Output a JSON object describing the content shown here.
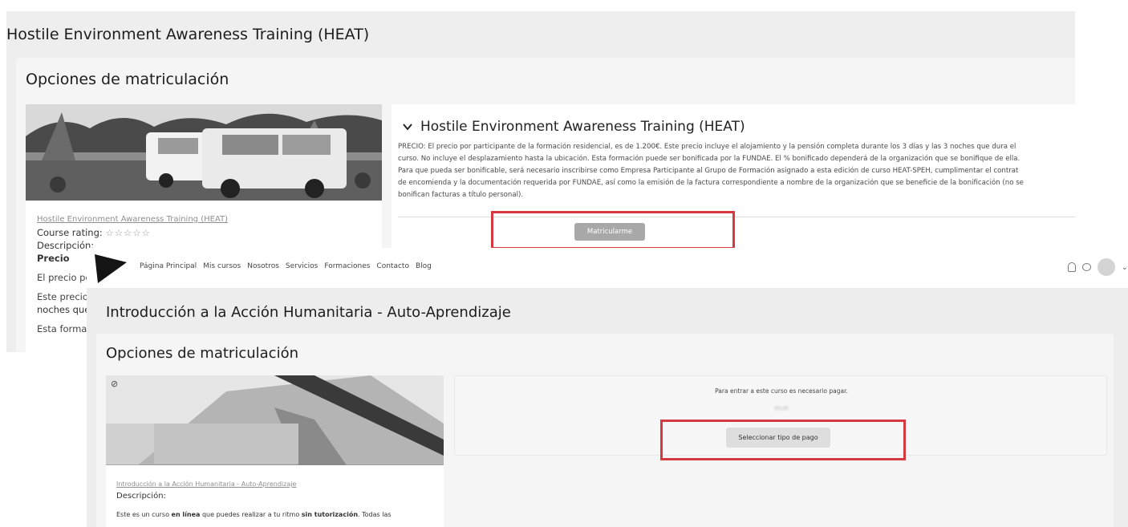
{
  "back": {
    "page_title": "Hostile Environment Awareness Training (HEAT)",
    "options_heading": "Opciones de matriculación",
    "course_link": "Hostile Environment Awareness Training (HEAT)",
    "rating_label": "Course rating:",
    "rating_stars": "☆☆☆☆☆",
    "description_label": "Descripción:",
    "price_label": "Precio",
    "para1": "El precio por",
    "para2a": "Este precio in",
    "para2b": "noches que d",
    "para3": "Esta formació",
    "accordion_title": "Hostile Environment Awareness Training (HEAT)",
    "accordion_lines": [
      "PRECIO: El precio por participante de la formación residencial, es de 1.200€. Este precio incluye el alojamiento y la pensión completa durante los 3 días y las 3 noches que dura el",
      "curso. No incluye el desplazamiento hasta la ubicación. Esta formación puede ser bonificada por la FUNDAE. El % bonificado dependerá de la organización que se bonifique de ella.",
      "Para que pueda ser bonificable, será necesario inscribirse como Empresa Participante al Grupo de Formación asignado a esta edición de curso HEAT-SPEH, cumplimentar el contrat",
      "de encomienda y la documentación requerida por FUNDAE, así como la emisión de la factura correspondiente a nombre de la organización que se beneficie de la bonificación (no se",
      "bonifican facturas a título personal)."
    ],
    "enrol_button": "Matricularme"
  },
  "front": {
    "nav": [
      "Página Principal",
      "Mis cursos",
      "Nosotros",
      "Servicios",
      "Formaciones",
      "Contacto",
      "Blog"
    ],
    "page_title": "Introducción a la Acción Humanitaria - Auto-Aprendizaje",
    "options_heading": "Opciones de matriculación",
    "course_link": "Introducción a la Acción Humanitaria - Auto-Aprendizaje",
    "description_label": "Descripción:",
    "desc_pre": "Este es un curso ",
    "desc_bold1": "en línea",
    "desc_mid": " que puedes realizar a tu ritmo ",
    "desc_bold2": "sin tutorización",
    "desc_post": ". Todas las",
    "pay_note": "Para entrar a este curso es necesario pagar.",
    "price": "€0,00",
    "pay_button": "Seleccionar tipo de pago"
  },
  "highlight_color": "#d63a40"
}
